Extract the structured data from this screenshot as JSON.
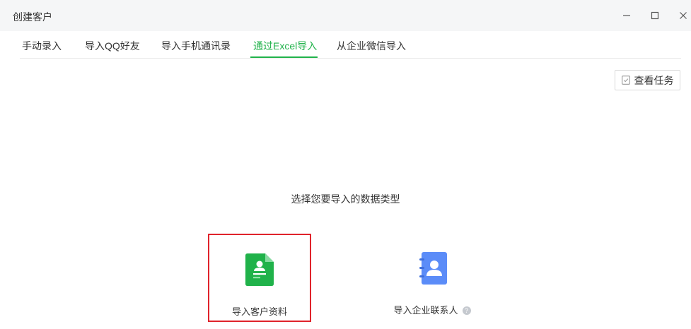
{
  "window": {
    "title": "创建客户"
  },
  "tabs": [
    {
      "label": "手动录入",
      "active": false
    },
    {
      "label": "导入QQ好友",
      "active": false
    },
    {
      "label": "导入手机通讯录",
      "active": false
    },
    {
      "label": "通过Excel导入",
      "active": true
    },
    {
      "label": "从企业微信导入",
      "active": false
    }
  ],
  "toolbar": {
    "view_tasks_label": "查看任务"
  },
  "prompt": "选择您要导入的数据类型",
  "options": [
    {
      "label": "导入客户资料",
      "icon": "customer-file-icon",
      "selected": true
    },
    {
      "label": "导入企业联系人",
      "icon": "contact-book-icon",
      "selected": false
    }
  ],
  "colors": {
    "accent": "#20b24a",
    "selection_border": "#e0232b",
    "contact_icon": "#5b8cf8"
  }
}
